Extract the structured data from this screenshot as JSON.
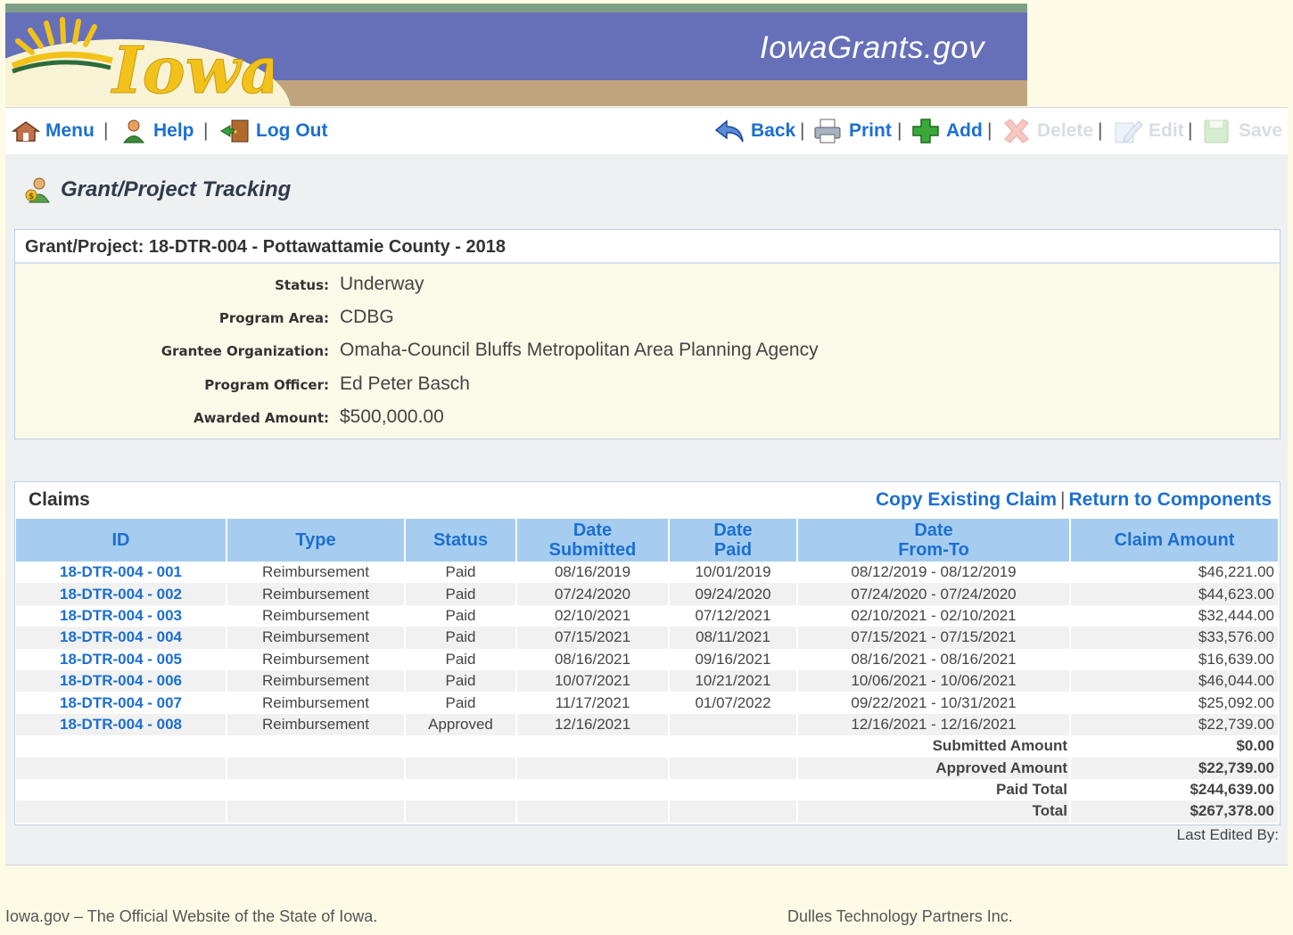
{
  "header": {
    "logo_text": "Iowa",
    "site_title": "IowaGrants.gov"
  },
  "toolbar": {
    "menu": "Menu",
    "help": "Help",
    "logout": "Log Out",
    "back": "Back",
    "print": "Print",
    "add": "Add",
    "delete": "Delete",
    "edit": "Edit",
    "save": "Save"
  },
  "page": {
    "title": "Grant/Project Tracking"
  },
  "project": {
    "heading": "Grant/Project: 18-DTR-004 - Pottawattamie County - 2018",
    "fields": [
      {
        "label": "Status:",
        "value": "Underway"
      },
      {
        "label": "Program Area:",
        "value": "CDBG"
      },
      {
        "label": "Grantee Organization:",
        "value": "Omaha-Council Bluffs Metropolitan Area Planning Agency"
      },
      {
        "label": "Program Officer:",
        "value": "Ed Peter Basch"
      },
      {
        "label": "Awarded Amount:",
        "value": "$500,000.00"
      }
    ]
  },
  "claims": {
    "title": "Claims",
    "copy_link": "Copy Existing Claim",
    "return_link": "Return to Components",
    "columns": {
      "id": "ID",
      "type": "Type",
      "status": "Status",
      "date_submitted_1": "Date",
      "date_submitted_2": "Submitted",
      "date_paid_1": "Date",
      "date_paid_2": "Paid",
      "date_range_1": "Date",
      "date_range_2": "From-To",
      "amount": "Claim Amount"
    },
    "rows": [
      {
        "id": "18-DTR-004 - 001",
        "type": "Reimbursement",
        "status": "Paid",
        "submitted": "08/16/2019",
        "paid": "10/01/2019",
        "range": "08/12/2019 - 08/12/2019",
        "amount": "$46,221.00"
      },
      {
        "id": "18-DTR-004 - 002",
        "type": "Reimbursement",
        "status": "Paid",
        "submitted": "07/24/2020",
        "paid": "09/24/2020",
        "range": "07/24/2020 - 07/24/2020",
        "amount": "$44,623.00"
      },
      {
        "id": "18-DTR-004 - 003",
        "type": "Reimbursement",
        "status": "Paid",
        "submitted": "02/10/2021",
        "paid": "07/12/2021",
        "range": "02/10/2021 - 02/10/2021",
        "amount": "$32,444.00"
      },
      {
        "id": "18-DTR-004 - 004",
        "type": "Reimbursement",
        "status": "Paid",
        "submitted": "07/15/2021",
        "paid": "08/11/2021",
        "range": "07/15/2021 - 07/15/2021",
        "amount": "$33,576.00"
      },
      {
        "id": "18-DTR-004 - 005",
        "type": "Reimbursement",
        "status": "Paid",
        "submitted": "08/16/2021",
        "paid": "09/16/2021",
        "range": "08/16/2021 - 08/16/2021",
        "amount": "$16,639.00"
      },
      {
        "id": "18-DTR-004 - 006",
        "type": "Reimbursement",
        "status": "Paid",
        "submitted": "10/07/2021",
        "paid": "10/21/2021",
        "range": "10/06/2021 - 10/06/2021",
        "amount": "$46,044.00"
      },
      {
        "id": "18-DTR-004 - 007",
        "type": "Reimbursement",
        "status": "Paid",
        "submitted": "11/17/2021",
        "paid": "01/07/2022",
        "range": "09/22/2021 - 10/31/2021",
        "amount": "$25,092.00"
      },
      {
        "id": "18-DTR-004 - 008",
        "type": "Reimbursement",
        "status": "Approved",
        "submitted": "12/16/2021",
        "paid": "",
        "range": "12/16/2021 - 12/16/2021",
        "amount": "$22,739.00"
      }
    ],
    "summary": [
      {
        "label": "Submitted Amount",
        "value": "$0.00"
      },
      {
        "label": "Approved Amount",
        "value": "$22,739.00"
      },
      {
        "label": "Paid Total",
        "value": "$244,639.00"
      },
      {
        "label": "Total",
        "value": "$267,378.00"
      }
    ],
    "last_edited": "Last Edited By:"
  },
  "footer": {
    "left": "Iowa.gov – The Official Website of the State of Iowa.",
    "right": "Dulles Technology Partners Inc."
  },
  "colors": {
    "link": "#1c6fd1",
    "header_purple": "#6670b8",
    "header_tan": "#c0a47e",
    "table_header": "#a6cdef"
  }
}
